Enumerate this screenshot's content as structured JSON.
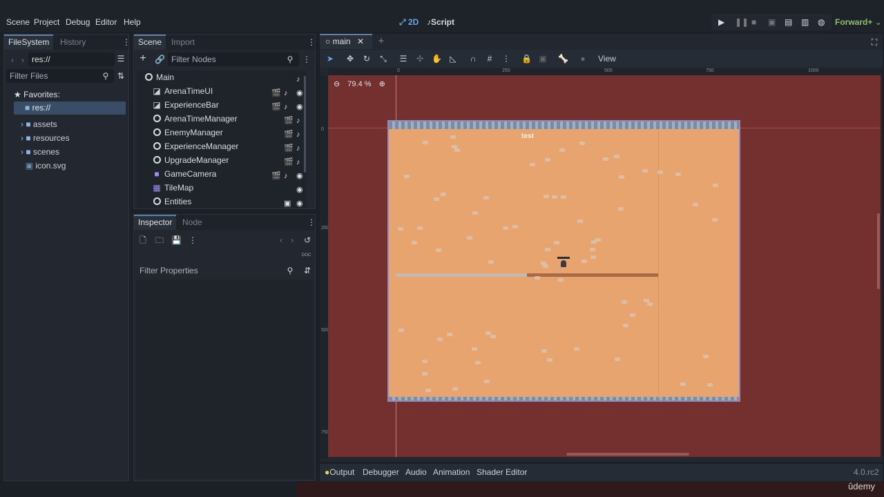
{
  "menu": {
    "items": [
      "Scene",
      "Project",
      "Debug",
      "Editor",
      "Help"
    ]
  },
  "workspace": {
    "mode_2d": "2D",
    "mode_script": "Script",
    "renderer": "Forward+"
  },
  "filesystem": {
    "tabs": [
      "FileSystem",
      "History"
    ],
    "path": "res://",
    "filter_placeholder": "Filter Files",
    "favorites": "Favorites:",
    "root": "res://",
    "items": [
      "assets",
      "resources",
      "scenes",
      "icon.svg"
    ]
  },
  "scene": {
    "tabs": [
      "Scene",
      "Import"
    ],
    "filter_placeholder": "Filter Nodes",
    "nodes": [
      "Main",
      "ArenaTimeUI",
      "ExperienceBar",
      "ArenaTimeManager",
      "EnemyManager",
      "ExperienceManager",
      "UpgradeManager",
      "GameCamera",
      "TileMap",
      "Entities"
    ]
  },
  "inspector": {
    "tabs": [
      "Inspector",
      "Node"
    ],
    "filter_placeholder": "Filter Properties",
    "doc": "DOC"
  },
  "editor": {
    "tab": "main",
    "view_menu": "View",
    "zoom": "79.4 %",
    "ruler_x": [
      "0",
      "250",
      "500",
      "750",
      "1000"
    ],
    "ruler_y": [
      "0",
      "250",
      "500",
      "750"
    ],
    "game_label": "test",
    "experience_fill": 0.5
  },
  "bottom": {
    "tabs": [
      "Output",
      "Debugger",
      "Audio",
      "Animation",
      "Shader Editor"
    ],
    "version": "4.0.rc2"
  },
  "watermark": "ûdemy",
  "colors": {
    "viewport": "#73302f",
    "ground": "#e7a46f",
    "accent": "#5f9ae0"
  }
}
